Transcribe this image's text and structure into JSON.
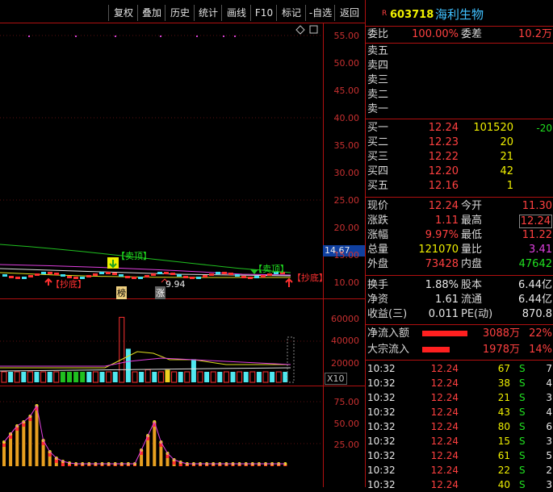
{
  "toolbar": {
    "buttons": [
      "复权",
      "叠加",
      "历史",
      "统计",
      "画线",
      "F10",
      "标记",
      "-自选",
      "返回"
    ]
  },
  "stock": {
    "badge": "R",
    "code": "603718",
    "name": "海利生物"
  },
  "price_axis": [
    "55.00",
    "50.00",
    "45.00",
    "40.00",
    "35.00",
    "30.00",
    "25.00",
    "20.00",
    "15.00",
    "10.00"
  ],
  "current_price_tag": "14.67",
  "vol_axis": [
    "60000",
    "40000",
    "20000"
  ],
  "vol_multiplier": "X10",
  "ind_axis": [
    "75.00",
    "50.00",
    "25.00"
  ],
  "chart_labels": {
    "sell_top_1": "【卖顶】",
    "sell_top_2": "【卖顶】",
    "buy_bottom_1": "【抄底】",
    "buy_bottom_2": "【抄底】",
    "low_price": "9.94",
    "badge_bang": "榜",
    "badge_zhang": "涨"
  },
  "orderbook": {
    "weibi_label": "委比",
    "weibi_value": "100.00%",
    "weicha_label": "委差",
    "weicha_value": "10.2万",
    "asks": [
      {
        "label": "卖五"
      },
      {
        "label": "卖四"
      },
      {
        "label": "卖三"
      },
      {
        "label": "卖二"
      },
      {
        "label": "卖一"
      }
    ],
    "bids": [
      {
        "label": "买一",
        "price": "12.24",
        "vol": "101520",
        "chg": "-20"
      },
      {
        "label": "买二",
        "price": "12.23",
        "vol": "20",
        "chg": ""
      },
      {
        "label": "买三",
        "price": "12.22",
        "vol": "21",
        "chg": ""
      },
      {
        "label": "买四",
        "price": "12.20",
        "vol": "42",
        "chg": ""
      },
      {
        "label": "买五",
        "price": "12.16",
        "vol": "1",
        "chg": ""
      }
    ]
  },
  "quote": {
    "xianjia": {
      "label": "现价",
      "value": "12.24"
    },
    "jinkai": {
      "label": "今开",
      "value": "11.30"
    },
    "zhangdie": {
      "label": "涨跌",
      "value": "1.11"
    },
    "zuigao": {
      "label": "最高",
      "value": "12.24"
    },
    "zhangfu": {
      "label": "涨幅",
      "value": "9.97%"
    },
    "zuidi": {
      "label": "最低",
      "value": "11.22"
    },
    "zongliang": {
      "label": "总量",
      "value": "121070"
    },
    "liangbi": {
      "label": "量比",
      "value": "3.41"
    },
    "waipan": {
      "label": "外盘",
      "value": "73428"
    },
    "neipan": {
      "label": "内盘",
      "value": "47642"
    }
  },
  "fundamentals": {
    "huanshou": {
      "label": "换手",
      "value": "1.88%"
    },
    "guben": {
      "label": "股本",
      "value": "6.44亿"
    },
    "jingzi": {
      "label": "净资",
      "value": "1.61"
    },
    "liutong": {
      "label": "流通",
      "value": "6.44亿"
    },
    "shouyi": {
      "label": "收益(三)",
      "value": "0.011"
    },
    "pe": {
      "label": "PE(动)",
      "value": "870.8"
    }
  },
  "flows": [
    {
      "label": "净流入额",
      "value": "3088万",
      "pct": "22%",
      "bar": 0.9
    },
    {
      "label": "大宗流入",
      "value": "1978万",
      "pct": "14%",
      "bar": 0.55
    }
  ],
  "ticks": [
    {
      "time": "10:32",
      "price": "12.24",
      "vol": "67",
      "side": "S",
      "n": "7"
    },
    {
      "time": "10:32",
      "price": "12.24",
      "vol": "38",
      "side": "S",
      "n": "4"
    },
    {
      "time": "10:32",
      "price": "12.24",
      "vol": "21",
      "side": "S",
      "n": "3"
    },
    {
      "time": "10:32",
      "price": "12.24",
      "vol": "43",
      "side": "S",
      "n": "4"
    },
    {
      "time": "10:32",
      "price": "12.24",
      "vol": "80",
      "side": "S",
      "n": "6"
    },
    {
      "time": "10:32",
      "price": "12.24",
      "vol": "15",
      "side": "S",
      "n": "3"
    },
    {
      "time": "10:32",
      "price": "12.24",
      "vol": "61",
      "side": "S",
      "n": "5"
    },
    {
      "time": "10:32",
      "price": "12.24",
      "vol": "22",
      "side": "S",
      "n": "2"
    },
    {
      "time": "10:32",
      "price": "12.24",
      "vol": "40",
      "side": "S",
      "n": "3"
    }
  ],
  "colors": {
    "up": "#ff4040",
    "down": "#20e020",
    "neutral": "#e8e8e8",
    "border": "#b01010",
    "volume_up": "#50e8f0"
  }
}
